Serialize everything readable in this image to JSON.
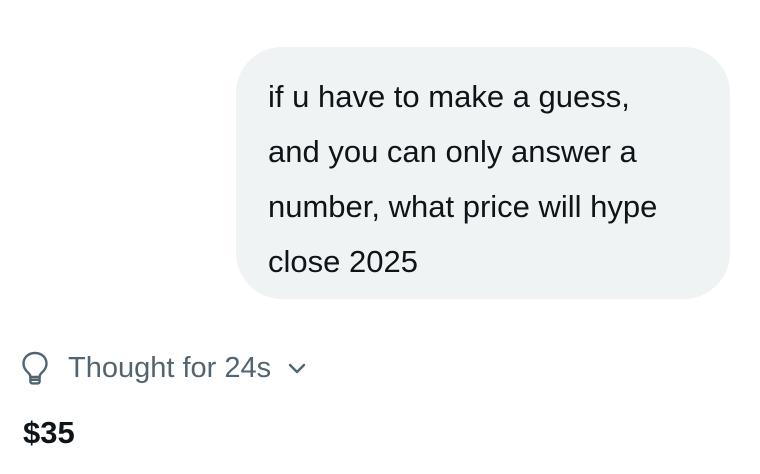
{
  "conversation": {
    "user_message": "if u have to make a guess,\nand you can only answer a\nnumber, what price will hype\nclose 2025",
    "thought": {
      "icon": "lightbulb-icon",
      "label": "Thought for 24s",
      "toggle_icon": "chevron-down-icon"
    },
    "assistant_answer": "$35"
  },
  "colors": {
    "bubble_background": "#eff3f4",
    "primary_text": "#0f1419",
    "secondary_text": "#536471"
  }
}
